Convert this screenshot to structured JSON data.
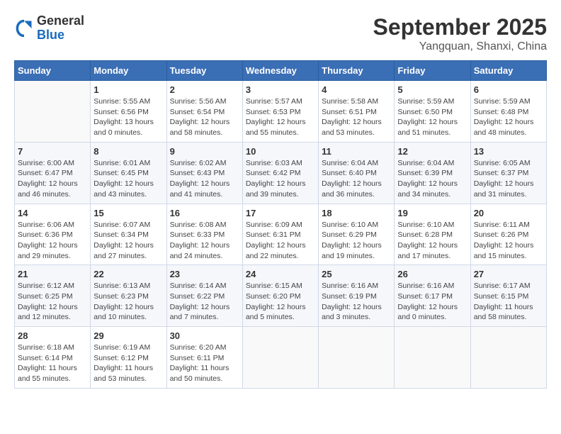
{
  "header": {
    "logo": {
      "general": "General",
      "blue": "Blue"
    },
    "title": "September 2025",
    "location": "Yangquan, Shanxi, China"
  },
  "weekdays": [
    "Sunday",
    "Monday",
    "Tuesday",
    "Wednesday",
    "Thursday",
    "Friday",
    "Saturday"
  ],
  "weeks": [
    [
      {
        "day": "",
        "info": ""
      },
      {
        "day": "1",
        "info": "Sunrise: 5:55 AM\nSunset: 6:56 PM\nDaylight: 13 hours\nand 0 minutes."
      },
      {
        "day": "2",
        "info": "Sunrise: 5:56 AM\nSunset: 6:54 PM\nDaylight: 12 hours\nand 58 minutes."
      },
      {
        "day": "3",
        "info": "Sunrise: 5:57 AM\nSunset: 6:53 PM\nDaylight: 12 hours\nand 55 minutes."
      },
      {
        "day": "4",
        "info": "Sunrise: 5:58 AM\nSunset: 6:51 PM\nDaylight: 12 hours\nand 53 minutes."
      },
      {
        "day": "5",
        "info": "Sunrise: 5:59 AM\nSunset: 6:50 PM\nDaylight: 12 hours\nand 51 minutes."
      },
      {
        "day": "6",
        "info": "Sunrise: 5:59 AM\nSunset: 6:48 PM\nDaylight: 12 hours\nand 48 minutes."
      }
    ],
    [
      {
        "day": "7",
        "info": "Sunrise: 6:00 AM\nSunset: 6:47 PM\nDaylight: 12 hours\nand 46 minutes."
      },
      {
        "day": "8",
        "info": "Sunrise: 6:01 AM\nSunset: 6:45 PM\nDaylight: 12 hours\nand 43 minutes."
      },
      {
        "day": "9",
        "info": "Sunrise: 6:02 AM\nSunset: 6:43 PM\nDaylight: 12 hours\nand 41 minutes."
      },
      {
        "day": "10",
        "info": "Sunrise: 6:03 AM\nSunset: 6:42 PM\nDaylight: 12 hours\nand 39 minutes."
      },
      {
        "day": "11",
        "info": "Sunrise: 6:04 AM\nSunset: 6:40 PM\nDaylight: 12 hours\nand 36 minutes."
      },
      {
        "day": "12",
        "info": "Sunrise: 6:04 AM\nSunset: 6:39 PM\nDaylight: 12 hours\nand 34 minutes."
      },
      {
        "day": "13",
        "info": "Sunrise: 6:05 AM\nSunset: 6:37 PM\nDaylight: 12 hours\nand 31 minutes."
      }
    ],
    [
      {
        "day": "14",
        "info": "Sunrise: 6:06 AM\nSunset: 6:36 PM\nDaylight: 12 hours\nand 29 minutes."
      },
      {
        "day": "15",
        "info": "Sunrise: 6:07 AM\nSunset: 6:34 PM\nDaylight: 12 hours\nand 27 minutes."
      },
      {
        "day": "16",
        "info": "Sunrise: 6:08 AM\nSunset: 6:33 PM\nDaylight: 12 hours\nand 24 minutes."
      },
      {
        "day": "17",
        "info": "Sunrise: 6:09 AM\nSunset: 6:31 PM\nDaylight: 12 hours\nand 22 minutes."
      },
      {
        "day": "18",
        "info": "Sunrise: 6:10 AM\nSunset: 6:29 PM\nDaylight: 12 hours\nand 19 minutes."
      },
      {
        "day": "19",
        "info": "Sunrise: 6:10 AM\nSunset: 6:28 PM\nDaylight: 12 hours\nand 17 minutes."
      },
      {
        "day": "20",
        "info": "Sunrise: 6:11 AM\nSunset: 6:26 PM\nDaylight: 12 hours\nand 15 minutes."
      }
    ],
    [
      {
        "day": "21",
        "info": "Sunrise: 6:12 AM\nSunset: 6:25 PM\nDaylight: 12 hours\nand 12 minutes."
      },
      {
        "day": "22",
        "info": "Sunrise: 6:13 AM\nSunset: 6:23 PM\nDaylight: 12 hours\nand 10 minutes."
      },
      {
        "day": "23",
        "info": "Sunrise: 6:14 AM\nSunset: 6:22 PM\nDaylight: 12 hours\nand 7 minutes."
      },
      {
        "day": "24",
        "info": "Sunrise: 6:15 AM\nSunset: 6:20 PM\nDaylight: 12 hours\nand 5 minutes."
      },
      {
        "day": "25",
        "info": "Sunrise: 6:16 AM\nSunset: 6:19 PM\nDaylight: 12 hours\nand 3 minutes."
      },
      {
        "day": "26",
        "info": "Sunrise: 6:16 AM\nSunset: 6:17 PM\nDaylight: 12 hours\nand 0 minutes."
      },
      {
        "day": "27",
        "info": "Sunrise: 6:17 AM\nSunset: 6:15 PM\nDaylight: 11 hours\nand 58 minutes."
      }
    ],
    [
      {
        "day": "28",
        "info": "Sunrise: 6:18 AM\nSunset: 6:14 PM\nDaylight: 11 hours\nand 55 minutes."
      },
      {
        "day": "29",
        "info": "Sunrise: 6:19 AM\nSunset: 6:12 PM\nDaylight: 11 hours\nand 53 minutes."
      },
      {
        "day": "30",
        "info": "Sunrise: 6:20 AM\nSunset: 6:11 PM\nDaylight: 11 hours\nand 50 minutes."
      },
      {
        "day": "",
        "info": ""
      },
      {
        "day": "",
        "info": ""
      },
      {
        "day": "",
        "info": ""
      },
      {
        "day": "",
        "info": ""
      }
    ]
  ]
}
